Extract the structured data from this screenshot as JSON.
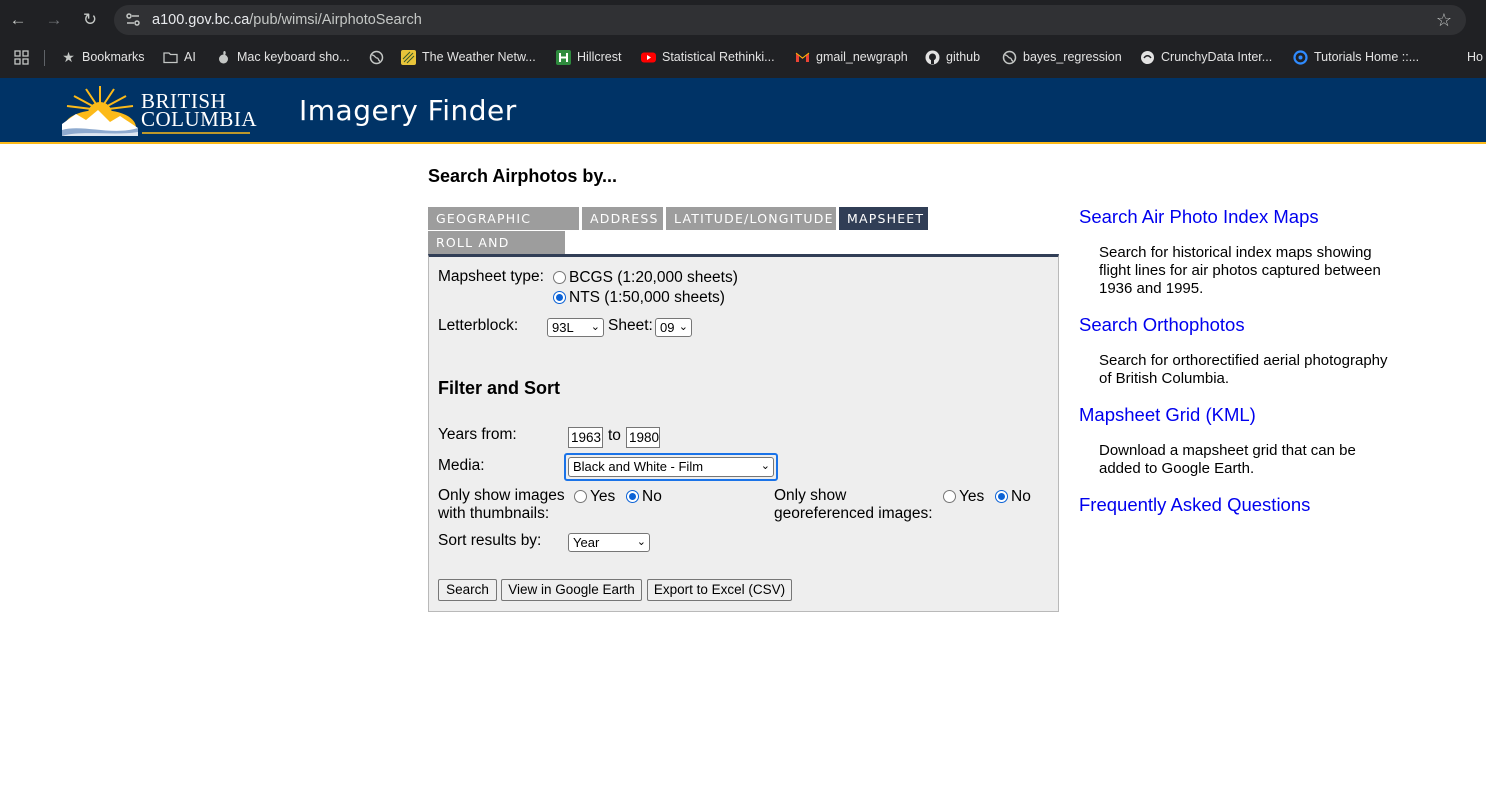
{
  "browser": {
    "url_host": "a100.gov.bc.ca",
    "url_path": "/pub/wimsi/AirphotoSearch",
    "bookmarks": [
      {
        "label": "Bookmarks",
        "icon": "star-icon"
      },
      {
        "label": "AI",
        "icon": "folder-icon"
      },
      {
        "label": "Mac keyboard sho...",
        "icon": "apple-icon"
      },
      {
        "label": "",
        "icon": "globe-icon"
      },
      {
        "label": "The Weather Netw...",
        "icon": "weather-icon"
      },
      {
        "label": "Hillcrest",
        "icon": "hillcrest-icon"
      },
      {
        "label": "Statistical Rethinki...",
        "icon": "youtube-icon"
      },
      {
        "label": "gmail_newgraph",
        "icon": "gmail-icon"
      },
      {
        "label": "github",
        "icon": "github-icon"
      },
      {
        "label": "bayes_regression",
        "icon": "globe-icon"
      },
      {
        "label": "CrunchyData Inter...",
        "icon": "crunchydata-icon"
      },
      {
        "label": "Tutorials Home ::...",
        "icon": "tutorials-icon"
      },
      {
        "label": "Ho",
        "icon": ""
      }
    ]
  },
  "header": {
    "logo_line1": "BRITISH",
    "logo_line2": "COLUMBIA",
    "title": "Imagery Finder"
  },
  "search": {
    "heading": "Search Airphotos by...",
    "tabs": [
      "GEOGRAPHIC NAME",
      "ADDRESS",
      "LATITUDE/LONGITUDE",
      "MAPSHEET",
      "ROLL AND FRAME"
    ],
    "active_tab": "MAPSHEET",
    "mapsheet_type_label": "Mapsheet type:",
    "mapsheet_options": [
      "BCGS (1:20,000 sheets)",
      "NTS (1:50,000 sheets)"
    ],
    "mapsheet_selected": "NTS (1:50,000 sheets)",
    "letterblock_label": "Letterblock:",
    "letterblock_value": "93L",
    "sheet_label": "Sheet:",
    "sheet_value": "09"
  },
  "filter": {
    "heading": "Filter and Sort",
    "years_label": "Years from:",
    "year_from": "1963",
    "to_label": "to",
    "year_to": "1980",
    "media_label": "Media:",
    "media_value": "Black and White - Film",
    "thumbnails_label_1": "Only show images",
    "thumbnails_label_2": "with thumbnails:",
    "thumbnails_selected": "No",
    "georef_label_1": "Only show",
    "georef_label_2": "georeferenced images:",
    "georef_selected": "No",
    "yes_label": "Yes",
    "no_label": "No",
    "sort_label": "Sort results by:",
    "sort_value": "Year"
  },
  "buttons": {
    "search": "Search",
    "google_earth": "View in Google Earth",
    "export": "Export to Excel (CSV)"
  },
  "sidebar": {
    "links": [
      {
        "title": "Search Air Photo Index Maps",
        "desc": "Search for historical index maps showing flight lines for air photos captured between 1936 and 1995."
      },
      {
        "title": "Search Orthophotos",
        "desc": "Search for orthorectified aerial photography of British Columbia."
      },
      {
        "title": "Mapsheet Grid (KML)",
        "desc": "Download a mapsheet grid that can be added to Google Earth."
      },
      {
        "title": "Frequently Asked Questions",
        "desc": ""
      }
    ]
  },
  "colors": {
    "bc_blue": "#003366",
    "bc_gold": "#fcba19",
    "tab_active": "#313e56",
    "tab_inactive": "#9d9d9d",
    "link": "#0000ee"
  }
}
